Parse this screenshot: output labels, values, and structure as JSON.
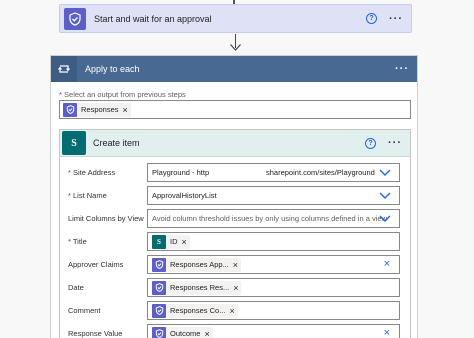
{
  "approval": {
    "title": "Start and wait for an approval",
    "help": "?",
    "menu": "···"
  },
  "apply": {
    "title": "Apply to each",
    "menu": "···",
    "select_label": "Select an output from previous steps",
    "token": "Responses"
  },
  "create": {
    "title": "Create item",
    "help": "?",
    "menu": "···",
    "sp_letter": "S",
    "fields": [
      {
        "label": "Site Address",
        "required": true,
        "value_left": "Playground - http",
        "value_right": "sharepoint.com/sites/Playground",
        "control": "dropdown"
      },
      {
        "label": "List Name",
        "required": true,
        "value": "ApprovalHistoryList",
        "control": "dropdown"
      },
      {
        "label": "Limit Columns by View",
        "required": false,
        "value": "Avoid column threshold issues by only using columns defined in a view",
        "control": "dropdown"
      },
      {
        "label": "Title",
        "required": true,
        "token": "ID",
        "token_type": "sharepoint"
      },
      {
        "label": "Approver Claims",
        "required": false,
        "token": "Responses App...",
        "token_type": "approval",
        "clear": true
      },
      {
        "label": "Date",
        "required": false,
        "token": "Responses Res...",
        "token_type": "approval"
      },
      {
        "label": "Comment",
        "required": false,
        "token": "Responses Co...",
        "token_type": "approval"
      },
      {
        "label": "Response Value",
        "required": false,
        "token": "Outcome",
        "token_type": "approval",
        "clear": true
      }
    ]
  },
  "colors": {
    "approval": "#5b5fc7",
    "sharepoint": "#036c70",
    "apply_header": "#486991",
    "link": "#2266e3"
  }
}
